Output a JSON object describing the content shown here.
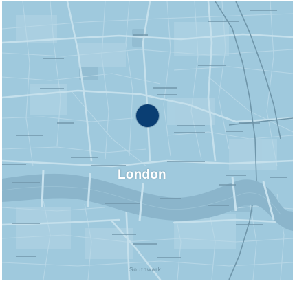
{
  "map": {
    "city_label": "London",
    "area_label": "Southwark",
    "marker_icon": "location-dot-icon",
    "colors": {
      "land": "#9fc9dd",
      "river": "#8bb5cb",
      "marker": "#0a3e73",
      "label": "#ffffff"
    }
  }
}
